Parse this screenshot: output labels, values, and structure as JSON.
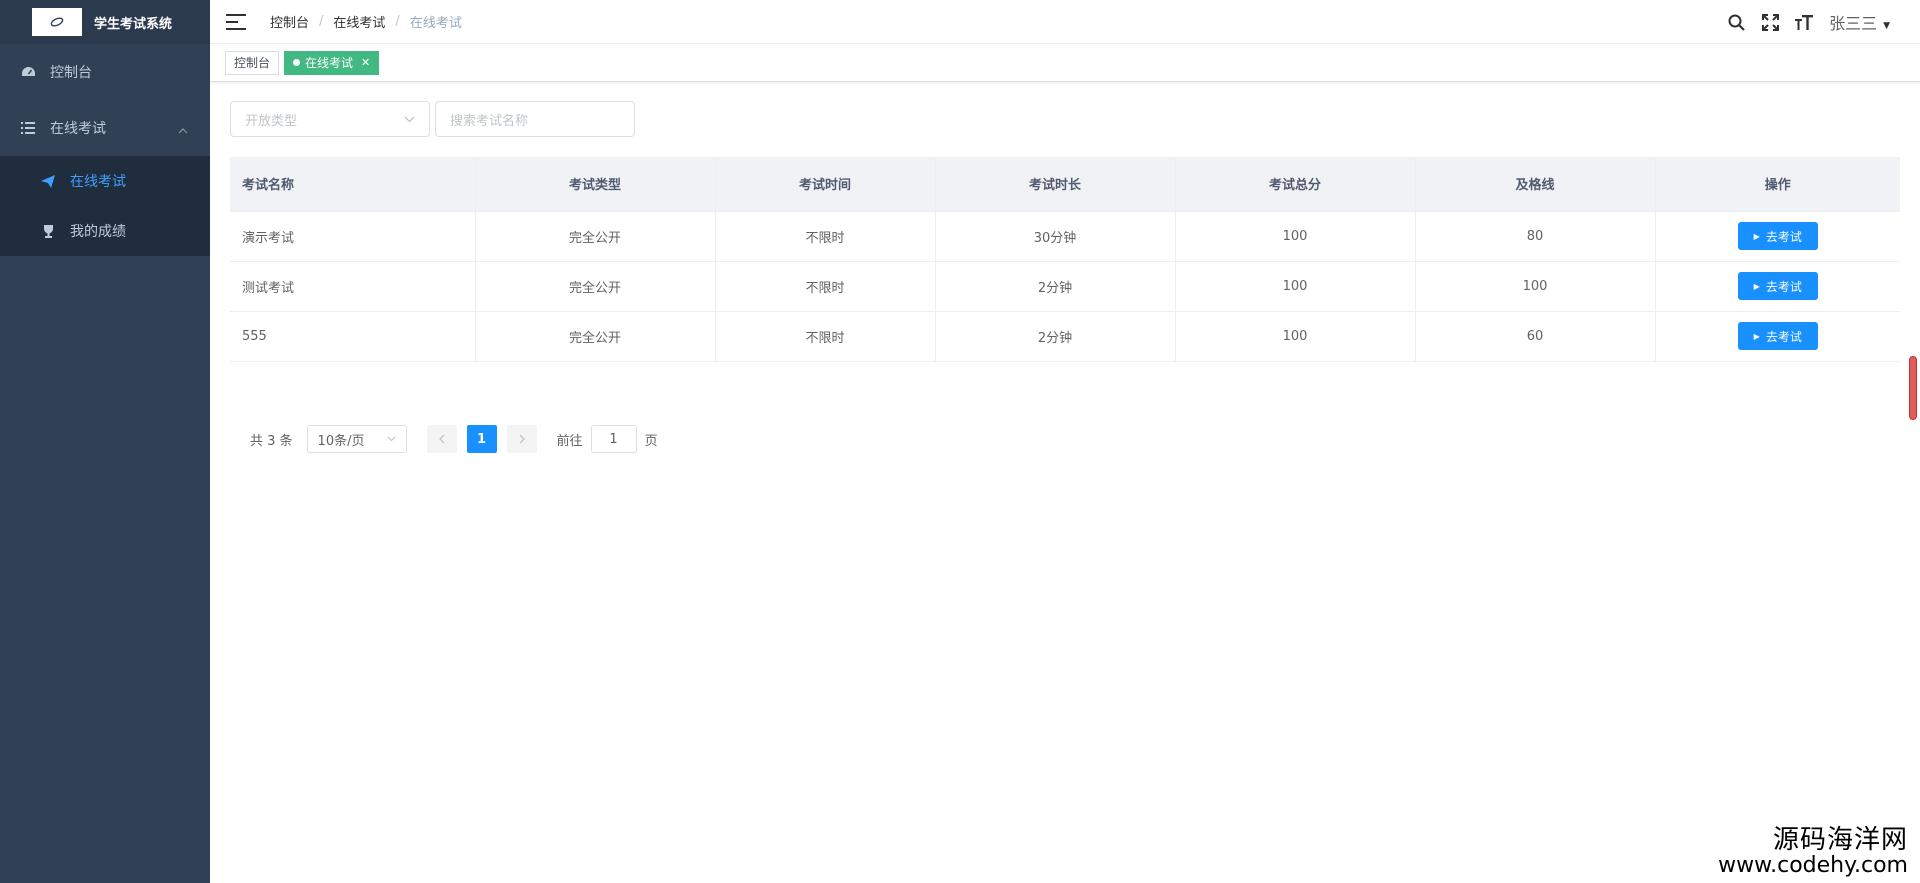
{
  "app": {
    "title": "学生考试系统"
  },
  "sidebar": {
    "items": [
      {
        "label": "控制台",
        "icon": "dashboard-icon"
      },
      {
        "label": "在线考试",
        "icon": "list-icon"
      }
    ],
    "submenu": [
      {
        "label": "在线考试",
        "icon": "send-icon",
        "active": true
      },
      {
        "label": "我的成绩",
        "icon": "trophy-icon",
        "active": false
      }
    ],
    "colors": {
      "bg": "#304156",
      "active": "#409eff"
    }
  },
  "header": {
    "breadcrumb": [
      "控制台",
      "在线考试",
      "在线考试"
    ],
    "username": "张三三"
  },
  "tags": [
    {
      "label": "控制台",
      "active": false
    },
    {
      "label": "在线考试",
      "active": true
    }
  ],
  "filters": {
    "type_placeholder": "开放类型",
    "search_placeholder": "搜索考试名称"
  },
  "table": {
    "columns": [
      "考试名称",
      "考试类型",
      "考试时间",
      "考试时长",
      "考试总分",
      "及格线",
      "操作"
    ],
    "rows": [
      [
        "演示考试",
        "完全公开",
        "不限时",
        "30分钟",
        "100",
        "80",
        "去考试"
      ],
      [
        "测试考试",
        "完全公开",
        "不限时",
        "2分钟",
        "100",
        "100",
        "去考试"
      ],
      [
        "555",
        "完全公开",
        "不限时",
        "2分钟",
        "100",
        "60",
        "去考试"
      ]
    ]
  },
  "pagination": {
    "total": "共 3 条",
    "page_size": "10条/页",
    "current": "1",
    "goto_label": "前往",
    "goto_value": "1",
    "goto_suffix": "页"
  },
  "watermark": {
    "line1": "源码海洋网",
    "line2": "www.codehy.com"
  }
}
